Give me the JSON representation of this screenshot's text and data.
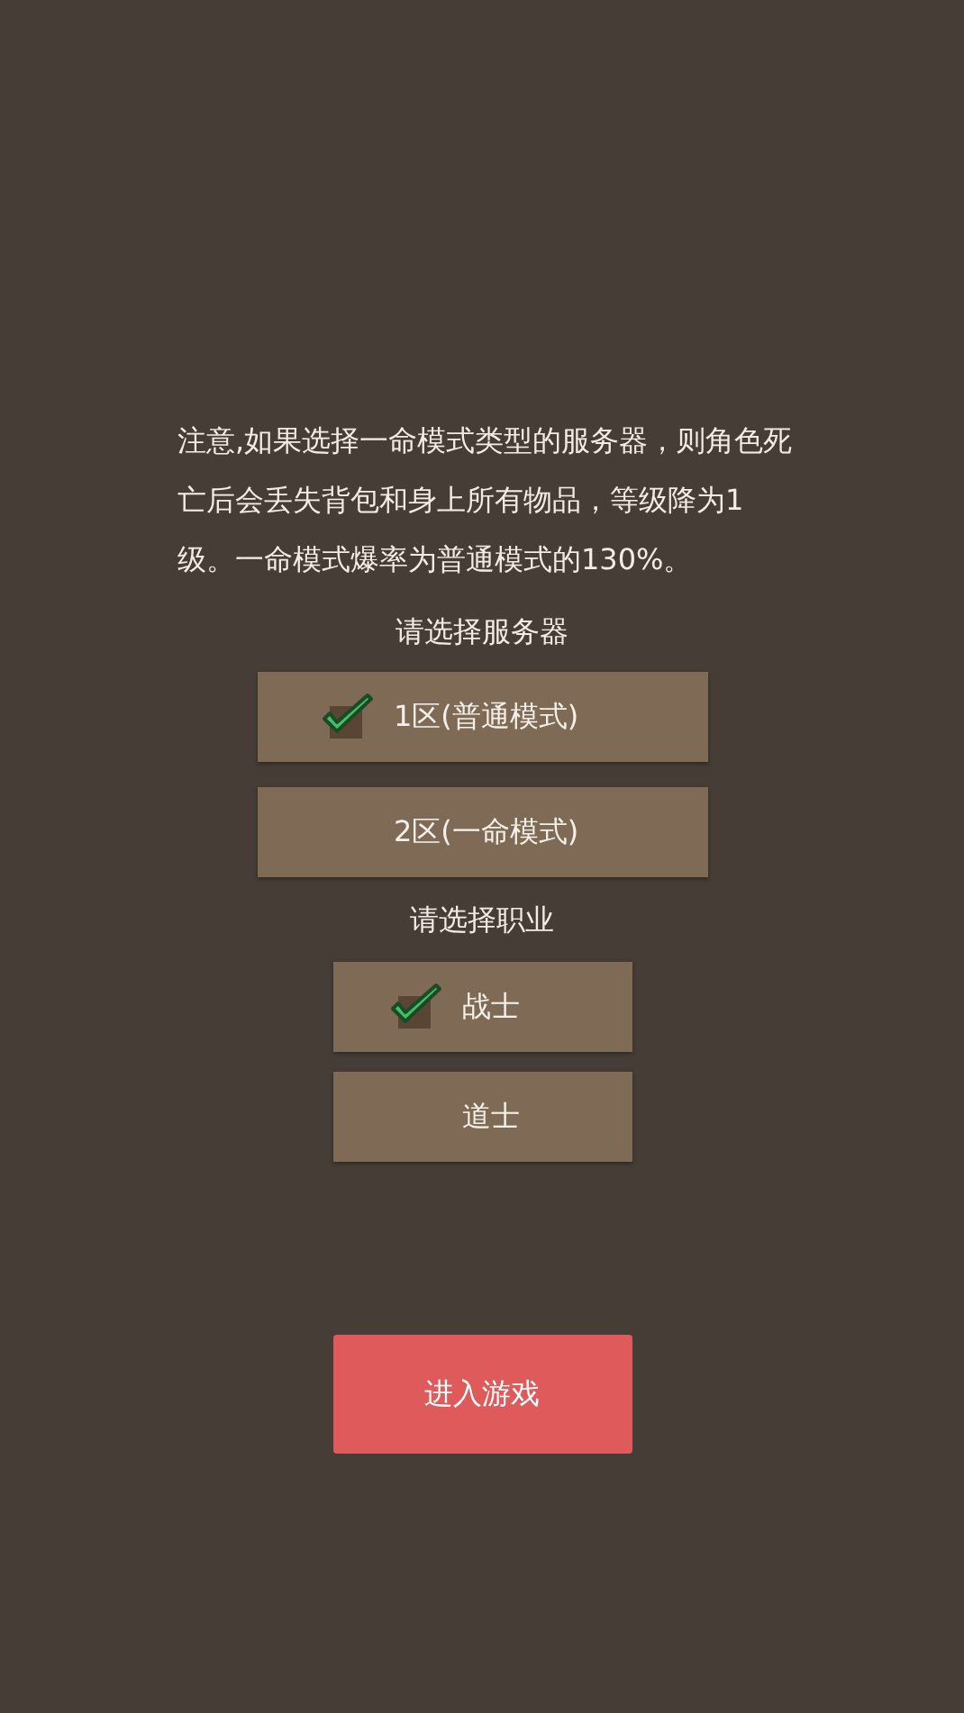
{
  "notice": "注意,如果选择一命模式类型的服务器，则角色死亡后会丢失背包和身上所有物品，等级降为1级。一命模式爆率为普通模式的130%。",
  "server_label": "请选择服务器",
  "servers": [
    {
      "label": "1区(普通模式)",
      "selected": true
    },
    {
      "label": "2区(一命模式)",
      "selected": false
    }
  ],
  "class_label": "请选择职业",
  "classes": [
    {
      "label": "战士",
      "selected": true
    },
    {
      "label": "道士",
      "selected": false
    }
  ],
  "enter_button": "进入游戏"
}
